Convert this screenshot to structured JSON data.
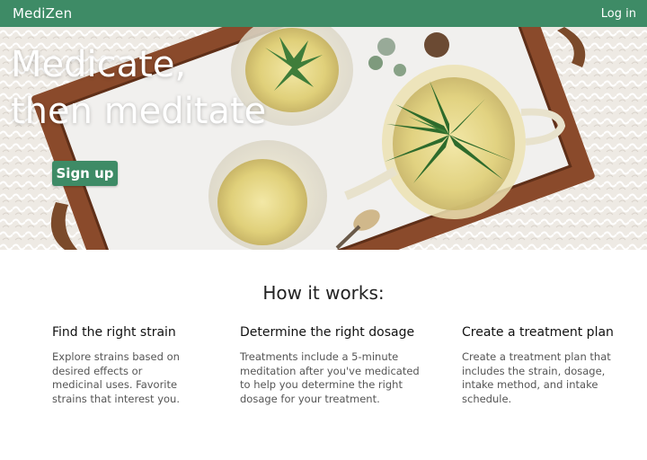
{
  "nav": {
    "brand": "MediZen",
    "login_label": "Log in"
  },
  "hero": {
    "title_line1": "Medicate,",
    "title_line2": "then meditate",
    "signup_label": "Sign up"
  },
  "how_it_works": {
    "title": "How it works:",
    "steps": [
      {
        "heading": "Find the right strain",
        "body": "Explore strains based on desired effects or medicinal uses. Favorite strains that interest you."
      },
      {
        "heading": "Determine the right dosage",
        "body": "Treatments include a 5-minute meditation after you've medicated to help you determine the right dosage for your treatment."
      },
      {
        "heading": "Create a treatment plan",
        "body": "Create a treatment plan that includes the strain, dosage, intake method, and intake schedule."
      }
    ]
  },
  "colors": {
    "brand_green": "#3e8b66",
    "nav_text": "#ffffff",
    "body_text": "#555555"
  }
}
